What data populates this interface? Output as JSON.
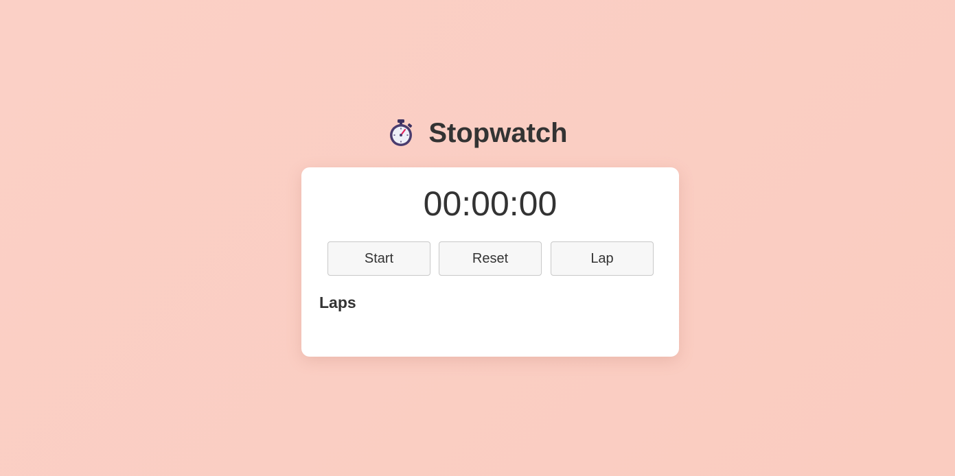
{
  "app": {
    "title": "Stopwatch",
    "icon": "stopwatch-icon"
  },
  "display": {
    "time": "00:00:00"
  },
  "controls": {
    "start_label": "Start",
    "reset_label": "Reset",
    "lap_label": "Lap"
  },
  "laps": {
    "heading": "Laps",
    "items": []
  },
  "colors": {
    "background": "#fbd0c6",
    "card": "#ffffff",
    "text": "#333333",
    "button_bg": "#f7f7f7",
    "button_border": "#c8c8c8"
  }
}
